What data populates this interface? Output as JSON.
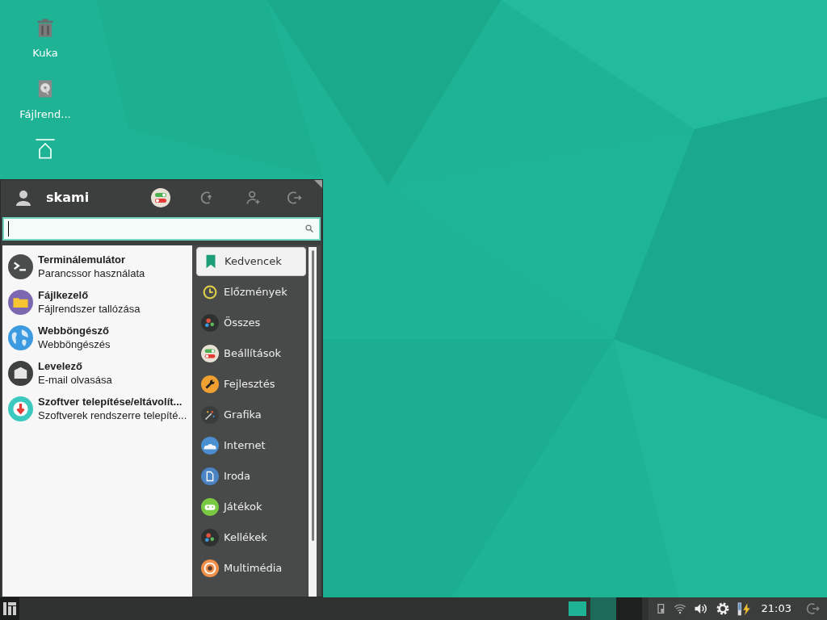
{
  "desktop_icons": [
    {
      "kind": "trash",
      "label": "Kuka"
    },
    {
      "kind": "drive",
      "label": "Fájlrend..."
    },
    {
      "kind": "home"
    }
  ],
  "menu": {
    "user": "skami",
    "favorites": [
      {
        "kind": "terminal",
        "title": "Terminálemulátor",
        "subtitle": "Parancssor használata"
      },
      {
        "kind": "files",
        "title": "Fájlkezelő",
        "subtitle": "Fájlrendszer tallózása"
      },
      {
        "kind": "web",
        "title": "Webböngésző",
        "subtitle": "Webböngészés"
      },
      {
        "kind": "mail",
        "title": "Levelező",
        "subtitle": "E-mail olvasása"
      },
      {
        "kind": "software",
        "title": "Szoftver telepítése/eltávolít...",
        "subtitle": "Szoftverek rendszerre telepíté..."
      }
    ],
    "categories": [
      {
        "kind": "bookmark",
        "label": "Kedvencek",
        "selected": true
      },
      {
        "kind": "clock",
        "label": "Előzmények",
        "selected": false
      },
      {
        "kind": "gears",
        "label": "Összes",
        "selected": false
      },
      {
        "kind": "switches",
        "label": "Beállítások",
        "selected": false
      },
      {
        "kind": "wrench",
        "label": "Fejlesztés",
        "selected": false
      },
      {
        "kind": "sparkle",
        "label": "Grafika",
        "selected": false
      },
      {
        "kind": "cloud",
        "label": "Internet",
        "selected": false
      },
      {
        "kind": "document",
        "label": "Iroda",
        "selected": false
      },
      {
        "kind": "gamepad",
        "label": "Játékok",
        "selected": false
      },
      {
        "kind": "gears",
        "label": "Kellékek",
        "selected": false
      },
      {
        "kind": "target",
        "label": "Multimédia",
        "selected": false
      }
    ]
  },
  "taskbar": {
    "workspaces": [
      {
        "selected": true
      },
      {
        "selected": false
      },
      {
        "selected": false
      }
    ],
    "clock": "21:03"
  }
}
